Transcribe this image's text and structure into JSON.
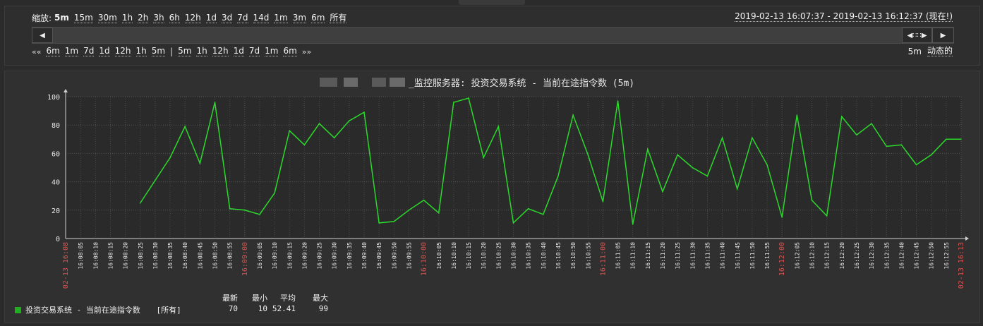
{
  "filter": {
    "zoom_label": "缩放:",
    "zoom_options": [
      "5m",
      "15m",
      "30m",
      "1h",
      "2h",
      "3h",
      "6h",
      "12h",
      "1d",
      "3d",
      "7d",
      "14d",
      "1m",
      "3m",
      "6m",
      "所有"
    ],
    "zoom_active": "5m",
    "period_text": "2019-02-13 16:07:37 - 2019-02-13 16:12:37 (现在!)",
    "nav_left_arrow": "««",
    "nav_left": [
      "6m",
      "1m",
      "7d",
      "1d",
      "12h",
      "1h",
      "5m"
    ],
    "nav_sep": "|",
    "nav_right": [
      "5m",
      "1h",
      "12h",
      "1d",
      "7d",
      "1m",
      "6m"
    ],
    "nav_right_arrow": "»»",
    "period_length": "5m",
    "dynamic_label": "动态的"
  },
  "graph": {
    "title": "_监控服务器: 投资交易系统 - 当前在途指令数 (5m)",
    "legend": {
      "item_name": "投资交易系统 - 当前在途指令数",
      "item_scope": "[所有]",
      "headers": [
        "最新",
        "最小",
        "平均",
        "最大"
      ],
      "values": [
        "70",
        "10",
        "52.41",
        "99"
      ],
      "color": "#1fae1f"
    }
  },
  "chart_data": {
    "type": "line",
    "title": "_监控服务器: 投资交易系统 - 当前在途指令数 (5m)",
    "ylim": [
      0,
      100
    ],
    "y_ticks": [
      0,
      20,
      40,
      60,
      80,
      100
    ],
    "grid": true,
    "x_tick_labels": [
      {
        "t": 0,
        "text": "02-13 16:08",
        "major": true
      },
      {
        "t": 1,
        "text": "16:08:05"
      },
      {
        "t": 2,
        "text": "16:08:10"
      },
      {
        "t": 3,
        "text": "16:08:15"
      },
      {
        "t": 4,
        "text": "16:08:20"
      },
      {
        "t": 5,
        "text": "16:08:25"
      },
      {
        "t": 6,
        "text": "16:08:30"
      },
      {
        "t": 7,
        "text": "16:08:35"
      },
      {
        "t": 8,
        "text": "16:08:40"
      },
      {
        "t": 9,
        "text": "16:08:45"
      },
      {
        "t": 10,
        "text": "16:08:50"
      },
      {
        "t": 11,
        "text": "16:08:55"
      },
      {
        "t": 12,
        "text": "16:09:00",
        "major": true
      },
      {
        "t": 13,
        "text": "16:09:05"
      },
      {
        "t": 14,
        "text": "16:09:10"
      },
      {
        "t": 15,
        "text": "16:09:15"
      },
      {
        "t": 16,
        "text": "16:09:20"
      },
      {
        "t": 17,
        "text": "16:09:25"
      },
      {
        "t": 18,
        "text": "16:09:30"
      },
      {
        "t": 19,
        "text": "16:09:35"
      },
      {
        "t": 20,
        "text": "16:09:40"
      },
      {
        "t": 21,
        "text": "16:09:45"
      },
      {
        "t": 22,
        "text": "16:09:50"
      },
      {
        "t": 23,
        "text": "16:09:55"
      },
      {
        "t": 24,
        "text": "16:10:00",
        "major": true
      },
      {
        "t": 25,
        "text": "16:10:05"
      },
      {
        "t": 26,
        "text": "16:10:10"
      },
      {
        "t": 27,
        "text": "16:10:15"
      },
      {
        "t": 28,
        "text": "16:10:20"
      },
      {
        "t": 29,
        "text": "16:10:25"
      },
      {
        "t": 30,
        "text": "16:10:30"
      },
      {
        "t": 31,
        "text": "16:10:35"
      },
      {
        "t": 32,
        "text": "16:10:40"
      },
      {
        "t": 33,
        "text": "16:10:45"
      },
      {
        "t": 34,
        "text": "16:10:50"
      },
      {
        "t": 35,
        "text": "16:10:55"
      },
      {
        "t": 36,
        "text": "16:11:00",
        "major": true
      },
      {
        "t": 37,
        "text": "16:11:05"
      },
      {
        "t": 38,
        "text": "16:11:10"
      },
      {
        "t": 39,
        "text": "16:11:15"
      },
      {
        "t": 40,
        "text": "16:11:20"
      },
      {
        "t": 41,
        "text": "16:11:25"
      },
      {
        "t": 42,
        "text": "16:11:30"
      },
      {
        "t": 43,
        "text": "16:11:35"
      },
      {
        "t": 44,
        "text": "16:11:40"
      },
      {
        "t": 45,
        "text": "16:11:45"
      },
      {
        "t": 46,
        "text": "16:11:50"
      },
      {
        "t": 47,
        "text": "16:11:55"
      },
      {
        "t": 48,
        "text": "16:12:00",
        "major": true
      },
      {
        "t": 49,
        "text": "16:12:05"
      },
      {
        "t": 50,
        "text": "16:12:10"
      },
      {
        "t": 51,
        "text": "16:12:15"
      },
      {
        "t": 52,
        "text": "16:12:20"
      },
      {
        "t": 53,
        "text": "16:12:25"
      },
      {
        "t": 54,
        "text": "16:12:30"
      },
      {
        "t": 55,
        "text": "16:12:35"
      },
      {
        "t": 56,
        "text": "16:12:40"
      },
      {
        "t": 57,
        "text": "16:12:45"
      },
      {
        "t": 58,
        "text": "16:12:50"
      },
      {
        "t": 59,
        "text": "16:12:55"
      },
      {
        "t": 60,
        "text": "02-13 16:13",
        "major": true
      }
    ],
    "series": [
      {
        "color": "#2bd92b",
        "points": [
          [
            5,
            25
          ],
          [
            7,
            57
          ],
          [
            8,
            79
          ],
          [
            9,
            53
          ],
          [
            10,
            96
          ],
          [
            11,
            21
          ],
          [
            12,
            20
          ],
          [
            13,
            17
          ],
          [
            14,
            32
          ],
          [
            15,
            76
          ],
          [
            16,
            66
          ],
          [
            17,
            81
          ],
          [
            18,
            71
          ],
          [
            19,
            83
          ],
          [
            20,
            89
          ],
          [
            21,
            11
          ],
          [
            22,
            12
          ],
          [
            23,
            20
          ],
          [
            24,
            27
          ],
          [
            25,
            18
          ],
          [
            26,
            96
          ],
          [
            27,
            99
          ],
          [
            28,
            57
          ],
          [
            29,
            79
          ],
          [
            30,
            11
          ],
          [
            31,
            21
          ],
          [
            32,
            17
          ],
          [
            33,
            44
          ],
          [
            34,
            87
          ],
          [
            35,
            59
          ],
          [
            36,
            26
          ],
          [
            37,
            97
          ],
          [
            38,
            10
          ],
          [
            39,
            63
          ],
          [
            40,
            33
          ],
          [
            41,
            59
          ],
          [
            42,
            50
          ],
          [
            43,
            44
          ],
          [
            44,
            71
          ],
          [
            45,
            35
          ],
          [
            46,
            71
          ],
          [
            47,
            52
          ],
          [
            48,
            15
          ],
          [
            49,
            87
          ],
          [
            50,
            27
          ],
          [
            51,
            16
          ],
          [
            52,
            86
          ],
          [
            53,
            73
          ],
          [
            54,
            81
          ],
          [
            55,
            65
          ],
          [
            56,
            66
          ],
          [
            57,
            52
          ],
          [
            58,
            59
          ],
          [
            59,
            70
          ],
          [
            60,
            70
          ]
        ]
      }
    ]
  }
}
